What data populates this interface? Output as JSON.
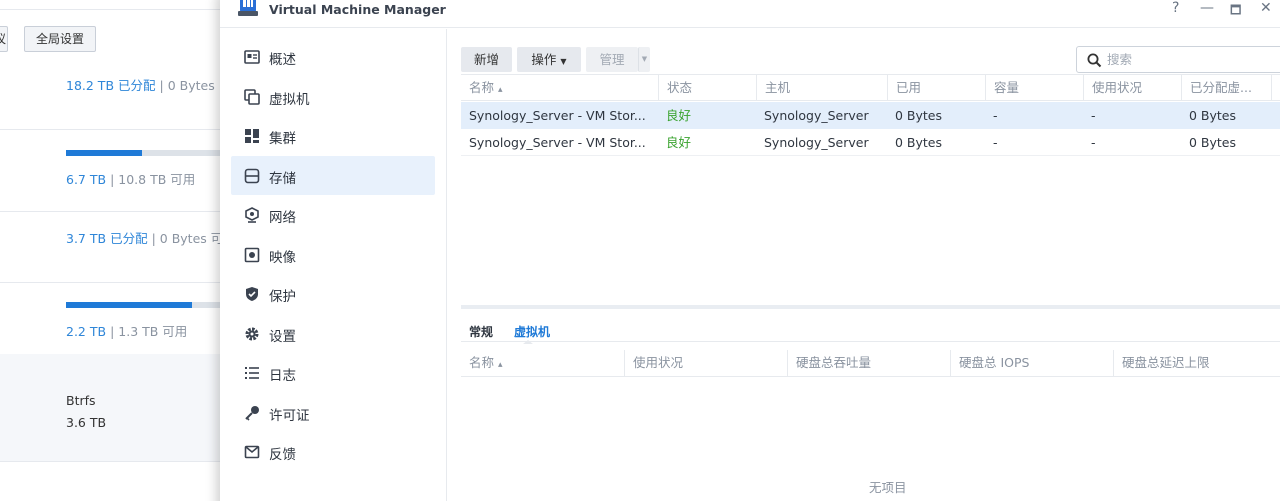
{
  "background": {
    "buttons": {
      "partial": "议",
      "global_settings": "全局设置"
    },
    "rows": [
      {
        "value": "18.2 TB",
        "value_suffix": "已分配",
        "rest": "0 Bytes"
      },
      {
        "value": "6.7 TB",
        "value_suffix": "",
        "rest": "10.8 TB 可用",
        "usage_fraction": 0.38
      },
      {
        "value": "3.7 TB",
        "value_suffix": "已分配",
        "rest": "0 Bytes 可"
      },
      {
        "value": "2.2 TB",
        "value_suffix": "",
        "rest": "1.3 TB 可用",
        "usage_fraction": 0.63
      }
    ],
    "separator": "|",
    "filesystem": "Btrfs",
    "size": "3.6 TB"
  },
  "window": {
    "title": "Virtual Machine Manager",
    "controls": {
      "help": "?",
      "minimize": "—",
      "maximize": "🗖",
      "close": "✕"
    }
  },
  "sidebar": {
    "items": [
      {
        "label": "概述",
        "icon": "overview-icon"
      },
      {
        "label": "虚拟机",
        "icon": "virtual-machine-icon"
      },
      {
        "label": "集群",
        "icon": "cluster-icon"
      },
      {
        "label": "存储",
        "icon": "storage-icon",
        "active": true
      },
      {
        "label": "网络",
        "icon": "network-icon"
      },
      {
        "label": "映像",
        "icon": "image-icon"
      },
      {
        "label": "保护",
        "icon": "protection-icon"
      },
      {
        "label": "设置",
        "icon": "settings-icon"
      },
      {
        "label": "日志",
        "icon": "log-icon"
      },
      {
        "label": "许可证",
        "icon": "license-icon"
      },
      {
        "label": "反馈",
        "icon": "feedback-icon"
      }
    ]
  },
  "toolbar": {
    "create": "新增",
    "action": "操作",
    "manage": "管理",
    "search_placeholder": "搜索"
  },
  "table": {
    "columns": [
      "名称",
      "状态",
      "主机",
      "已用",
      "容量",
      "使用状况",
      "已分配虚..."
    ],
    "sort_indicator": "▴",
    "more_icon": "⋮",
    "rows": [
      {
        "name": "Synology_Server - VM Stor...",
        "status": "良好",
        "host": "Synology_Server",
        "used": "0 Bytes",
        "capacity": "-",
        "usage": "-",
        "allocated": "0 Bytes",
        "selected": true
      },
      {
        "name": "Synology_Server - VM Stor...",
        "status": "良好",
        "host": "Synology_Server",
        "used": "0 Bytes",
        "capacity": "-",
        "usage": "-",
        "allocated": "0 Bytes",
        "selected": false
      }
    ]
  },
  "detail": {
    "tabs": [
      {
        "label": "常规",
        "active": false
      },
      {
        "label": "虚拟机",
        "active": true
      }
    ],
    "columns": [
      "名称",
      "使用状况",
      "硬盘总吞吐量",
      "硬盘总 IOPS",
      "硬盘总延迟上限"
    ],
    "empty_text": "无项目"
  },
  "colors": {
    "accent": "#1f7ad7",
    "ok": "#3aa32f",
    "selected_row": "#e3eefb",
    "active_nav": "#e8f1fc"
  }
}
